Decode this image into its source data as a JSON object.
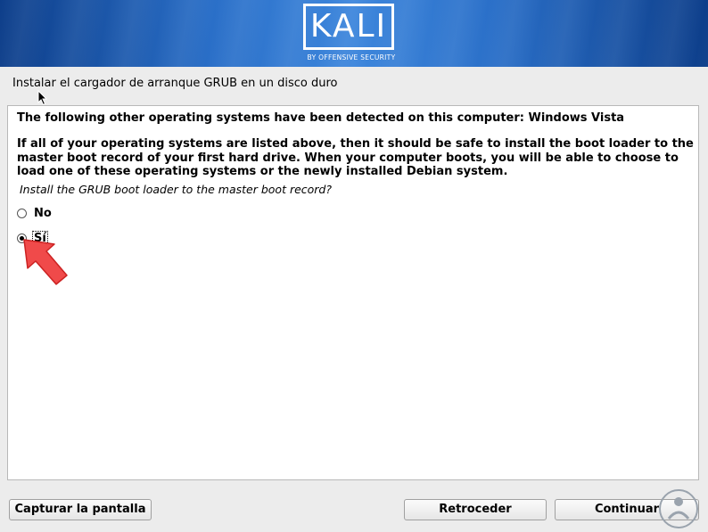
{
  "banner": {
    "logo_text": "KALI",
    "logo_subtitle": "BY OFFENSIVE SECURITY"
  },
  "step_title": "Instalar el cargador de arranque GRUB en un disco duro",
  "content": {
    "detected_text": "The following other operating systems have been detected on this computer: Windows Vista",
    "explanation_text": "If all of your operating systems are listed above, then it should be safe to install the boot loader to the master boot record of your first hard drive. When your computer boots, you will be able to choose to load one of these operating systems or the newly installed Debian system.",
    "question": "Install the GRUB boot loader to the master boot record?",
    "options": [
      {
        "label": "No",
        "selected": false
      },
      {
        "label": "Sí",
        "selected": true
      }
    ]
  },
  "buttons": {
    "screenshot": "Capturar la pantalla",
    "back": "Retroceder",
    "continue": "Continuar"
  },
  "colors": {
    "banner_dark": "#0d3e8a",
    "banner_light": "#3d86dc",
    "arrow": "#f04a4a"
  },
  "icons": {
    "annotation": "red-arrow-icon",
    "pointer": "mouse-cursor-icon",
    "watermark": "solvetic-logo-icon"
  }
}
